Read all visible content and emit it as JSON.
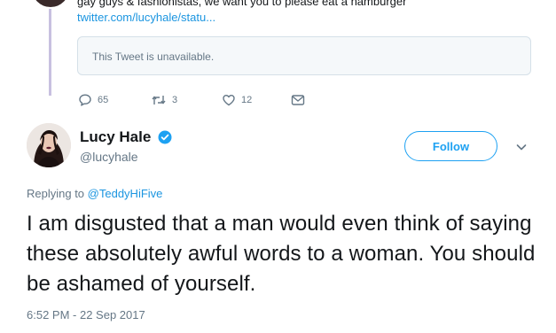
{
  "previous_tweet": {
    "text": "gay guys & fashionistas, we want you to please eat a hamburger",
    "link": "twitter.com/lucyhale/statu...",
    "quoted_notice": "This Tweet is unavailable.",
    "actions": {
      "replies": "65",
      "retweets": "3",
      "likes": "12"
    }
  },
  "tweet": {
    "author_name": "Lucy Hale",
    "author_handle": "@lucyhale",
    "verified": true,
    "follow_label": "Follow",
    "replying_prefix": "Replying to",
    "replying_to": "@TeddyHiFive",
    "text": "I am disgusted that a man would even think of saying these absolutely awful words to a woman. You should be ashamed of yourself.",
    "timestamp": "6:52 PM - 22 Sep 2017"
  },
  "colors": {
    "accent": "#1da1f2",
    "link": "#1b95e0",
    "muted": "#657786",
    "thread_line": "#c8c0e0"
  },
  "icons": {
    "reply": "reply-icon",
    "retweet": "retweet-icon",
    "like": "heart-icon",
    "message": "direct-message-icon",
    "verified": "verified-badge-icon",
    "more": "chevron-down-icon"
  }
}
